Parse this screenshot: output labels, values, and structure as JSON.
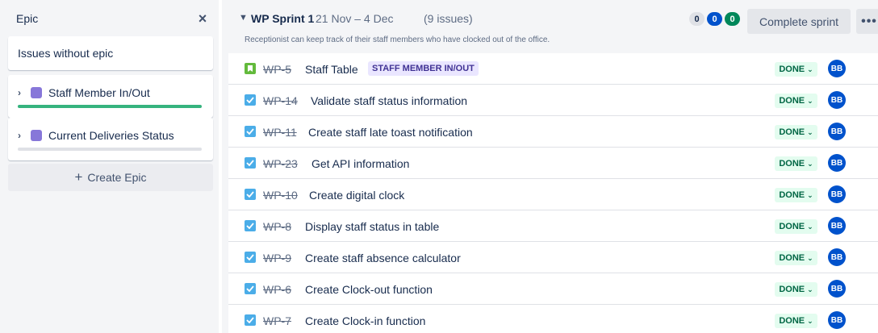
{
  "epic_panel": {
    "title": "Epic",
    "close_glyph": "×",
    "issues_without_epic": "Issues without epic",
    "epics": [
      {
        "name": "Staff Member In/Out",
        "color": "#8777d9",
        "progress_done_fraction": 1.0
      },
      {
        "name": "Current Deliveries Status",
        "color": "#8777d9",
        "progress_done_fraction": 0.0
      }
    ],
    "create_epic_label": "Create Epic",
    "create_epic_glyph": "+"
  },
  "sprint": {
    "name": "WP Sprint 1",
    "dates": "21 Nov – 4 Dec",
    "issue_count": "(9 issues)",
    "goal": "Receptionist can keep track of their staff members who have clocked out of the office.",
    "counts": {
      "todo": "0",
      "in_progress": "0",
      "done": "0"
    },
    "complete_label": "Complete sprint",
    "more_glyph": "•••"
  },
  "issues": [
    {
      "type": "story",
      "key": "WP-5",
      "summary": "Staff Table",
      "epic": "STAFF MEMBER IN/OUT",
      "status": "DONE",
      "assignee": "BB"
    },
    {
      "type": "task",
      "key": "WP-14",
      "summary": "Validate staff status information",
      "epic": "",
      "status": "DONE",
      "assignee": "BB"
    },
    {
      "type": "task",
      "key": "WP-11",
      "summary": "Create staff late toast notification",
      "epic": "",
      "status": "DONE",
      "assignee": "BB"
    },
    {
      "type": "task",
      "key": "WP-23",
      "summary": "Get API information",
      "epic": "",
      "status": "DONE",
      "assignee": "BB"
    },
    {
      "type": "task",
      "key": "WP-10",
      "summary": "Create digital clock",
      "epic": "",
      "status": "DONE",
      "assignee": "BB"
    },
    {
      "type": "task",
      "key": "WP-8",
      "summary": "Display staff status in table",
      "epic": "",
      "status": "DONE",
      "assignee": "BB"
    },
    {
      "type": "task",
      "key": "WP-9",
      "summary": "Create staff absence calculator",
      "epic": "",
      "status": "DONE",
      "assignee": "BB"
    },
    {
      "type": "task",
      "key": "WP-6",
      "summary": "Create Clock-out function",
      "epic": "",
      "status": "DONE",
      "assignee": "BB"
    },
    {
      "type": "task",
      "key": "WP-7",
      "summary": "Create Clock-in function",
      "epic": "",
      "status": "DONE",
      "assignee": "BB"
    }
  ],
  "colors": {
    "epic_lozenge_bg": "#eae6ff",
    "epic_lozenge_text": "#403294",
    "done_lozenge_bg": "#e3fcef",
    "done_lozenge_text": "#006644",
    "avatar_bg": "#0052cc"
  }
}
